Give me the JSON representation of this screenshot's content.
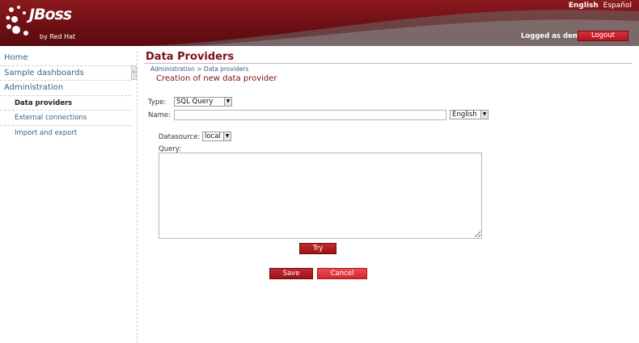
{
  "header": {
    "logo_text": "JBoss",
    "logo_subtext": "by Red Hat",
    "languages": [
      "English",
      "Español"
    ],
    "active_language": "English",
    "logged_as": "Logged as demo",
    "logout_label": "Logout"
  },
  "sidebar": {
    "items": [
      {
        "label": "Home"
      },
      {
        "label": "Sample dashboards"
      },
      {
        "label": "Administration"
      },
      {
        "label": "Data providers"
      },
      {
        "label": "External connections"
      },
      {
        "label": "Import and export"
      }
    ],
    "collapse_glyph": "«"
  },
  "main": {
    "title": "Data Providers",
    "breadcrumb": "Administration > Data providers",
    "subtitle": "Creation of new data provider",
    "type_label": "Type:",
    "type_value": "SQL Query",
    "name_label": "Name:",
    "name_value": "",
    "name_language": "English",
    "datasource_label": "Datasource:",
    "datasource_value": "local",
    "query_label": "Query:",
    "query_value": "",
    "try_label": "Try",
    "save_label": "Save",
    "cancel_label": "Cancel"
  },
  "colors": {
    "brand": "#7a1018",
    "header_bg": "#6e0f14",
    "button_red": "#b5151f",
    "link": "#36608a"
  }
}
